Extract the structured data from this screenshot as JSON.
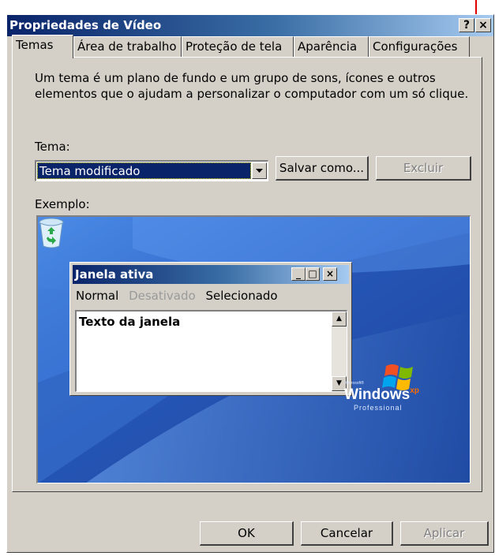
{
  "window": {
    "title": "Propriedades de Vídeo",
    "help_glyph": "?",
    "close_glyph": "×"
  },
  "tabs": [
    {
      "label": "Temas",
      "active": true
    },
    {
      "label": "Área de trabalho",
      "active": false
    },
    {
      "label": "Proteção de tela",
      "active": false
    },
    {
      "label": "Aparência",
      "active": false
    },
    {
      "label": "Configurações",
      "active": false
    }
  ],
  "description": "Um tema é um plano de fundo e um grupo de sons, ícones e outros elementos que o ajudam a personalizar o computador com um só clique.",
  "theme": {
    "label": "Tema:",
    "selected": "Tema modificado",
    "save_as_label": "Salvar como...",
    "delete_label": "Excluir"
  },
  "preview": {
    "label": "Exemplo:",
    "window_title": "Janela ativa",
    "menu": {
      "normal": "Normal",
      "disabled": "Desativado",
      "selected": "Selecionado"
    },
    "window_text": "Texto da janela",
    "logo": {
      "ms": "Microsoft®",
      "word": "Windows",
      "xp": "xp",
      "edition": "Professional"
    }
  },
  "footer": {
    "ok_label": "OK",
    "cancel_label": "Cancelar",
    "apply_label": "Aplicar"
  },
  "colors": {
    "annotation_arrow": "#e00000",
    "titlebar_start": "#0a246a",
    "titlebar_end": "#a6caf0",
    "face": "#d4d0c8"
  }
}
